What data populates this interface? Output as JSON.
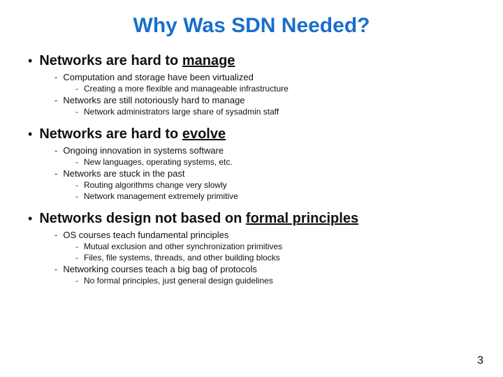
{
  "slide": {
    "title": "Why Was SDN Needed?",
    "page_number": "3",
    "sections": [
      {
        "id": "section1",
        "main_text_before_underline": "Networks are hard to ",
        "main_underline": "manage",
        "sub_items": [
          {
            "text": "Computation and storage have been virtualized",
            "sub_sub_items": [
              "Creating a more flexible and manageable infrastructure"
            ]
          },
          {
            "text": "Networks are still notoriously hard to manage",
            "sub_sub_items": [
              "Network administrators large share of sysadmin staff"
            ]
          }
        ]
      },
      {
        "id": "section2",
        "main_text_before_underline": "Networks are hard to ",
        "main_underline": "evolve",
        "sub_items": [
          {
            "text": "Ongoing innovation in systems software",
            "sub_sub_items": [
              "New languages, operating systems, etc."
            ]
          },
          {
            "text": "Networks are stuck in the past",
            "sub_sub_items": [
              "Routing algorithms change very slowly",
              "Network management extremely primitive"
            ]
          }
        ]
      },
      {
        "id": "section3",
        "main_text_before_underline": "Networks design not based on ",
        "main_underline": "formal principles",
        "sub_items": [
          {
            "text": "OS courses teach fundamental principles",
            "sub_sub_items": [
              "Mutual exclusion and other synchronization primitives",
              "Files, file systems, threads, and other building blocks"
            ]
          },
          {
            "text": "Networking courses teach a big bag of protocols",
            "sub_sub_items": [
              "No formal principles, just general design guidelines"
            ]
          }
        ]
      }
    ]
  }
}
